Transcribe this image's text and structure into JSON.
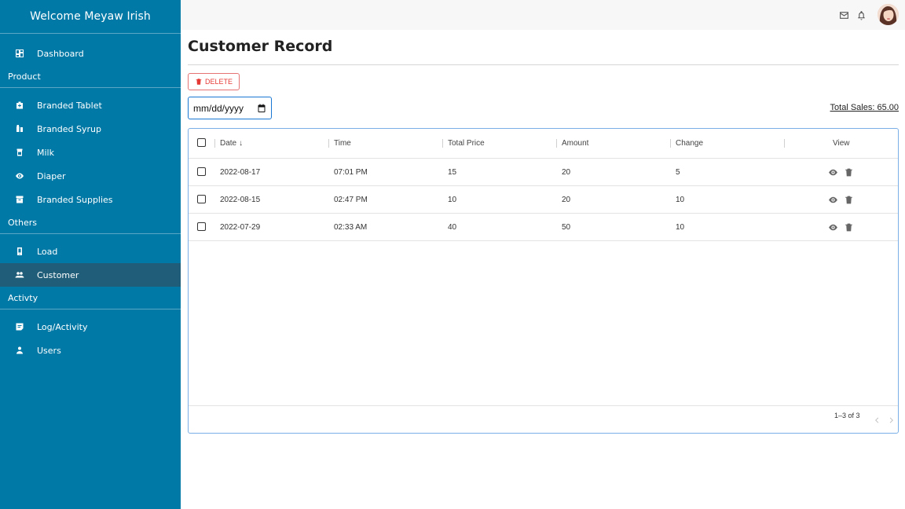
{
  "sidebar": {
    "welcome": "Welcome  Meyaw Irish",
    "dashboard": {
      "label": "Dashboard",
      "icon": "dashboard-icon"
    },
    "sections": [
      {
        "title": "Product",
        "items": [
          {
            "label": "Branded Tablet",
            "icon": "medical-kit-icon"
          },
          {
            "label": "Branded Syrup",
            "icon": "bottle-icon"
          },
          {
            "label": "Milk",
            "icon": "milk-can-icon"
          },
          {
            "label": "Diaper",
            "icon": "eye-icon"
          },
          {
            "label": "Branded Supplies",
            "icon": "archive-icon"
          }
        ]
      },
      {
        "title": "Others",
        "items": [
          {
            "label": "Load",
            "icon": "phone-icon"
          },
          {
            "label": "Customer",
            "icon": "people-icon",
            "active": true
          }
        ]
      },
      {
        "title": "Activty",
        "items": [
          {
            "label": "Log/Activity",
            "icon": "note-icon"
          },
          {
            "label": "Users",
            "icon": "person-icon"
          }
        ]
      }
    ]
  },
  "topbar": {
    "mail_icon": "mail-icon",
    "bell_icon": "bell-icon",
    "avatar": "avatar"
  },
  "main": {
    "title": "Customer Record",
    "delete_label": "DELETE",
    "date_placeholder": "mm/dd/yyyy",
    "total_sales": "Total Sales: 65.00"
  },
  "table": {
    "columns": [
      "Date",
      "Time",
      "Total Price",
      "Amount",
      "Change",
      "View"
    ],
    "sort_indicator": "↓",
    "rows": [
      {
        "date": "2022-08-17",
        "time": "07:01 PM",
        "total_price": "15",
        "amount": "20",
        "change": "5"
      },
      {
        "date": "2022-08-15",
        "time": "02:47 PM",
        "total_price": "10",
        "amount": "20",
        "change": "10"
      },
      {
        "date": "2022-07-29",
        "time": "02:33 AM",
        "total_price": "40",
        "amount": "50",
        "change": "10"
      }
    ],
    "pagination": "1–3 of 3"
  },
  "colors": {
    "sidebar_bg": "#0079a6",
    "active_item": "#1f5d78",
    "accent": "#1976d2",
    "danger": "#e53935"
  }
}
